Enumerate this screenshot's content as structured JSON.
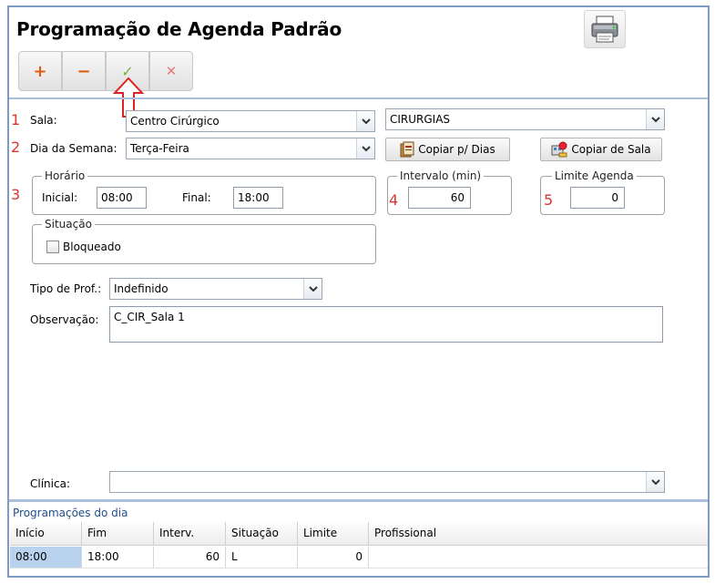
{
  "title": "Programação de Agenda Padrão",
  "toolbar": {
    "add": "+",
    "remove": "−",
    "confirm": "✓",
    "cancel": "✕"
  },
  "annotations": [
    "1",
    "2",
    "3",
    "4",
    "5"
  ],
  "form": {
    "sala_label": "Sala:",
    "sala_value": "Centro Cirúrgico",
    "sala_group_value": "CIRURGIAS",
    "dia_label": "Dia da Semana:",
    "dia_value": "Terça-Feira",
    "copiar_dias": "Copiar p/ Dias",
    "copiar_sala": "Copiar de Sala",
    "horario_legend": "Horário",
    "inicial_label": "Inicial:",
    "inicial_value": "08:00",
    "final_label": "Final:",
    "final_value": "18:00",
    "intervalo_legend": "Intervalo (min)",
    "intervalo_value": "60",
    "limite_legend": "Limite Agenda",
    "limite_value": "0",
    "situacao_legend": "Situação",
    "bloqueado_label": "Bloqueado",
    "tipo_prof_label": "Tipo de Prof.:",
    "tipo_prof_value": "Indefinido",
    "observacao_label": "Observação:",
    "observacao_value": "C_CIR_Sala 1",
    "clinica_label": "Clínica:",
    "clinica_value": ""
  },
  "grid": {
    "title": "Programações do dia",
    "columns": [
      "Início",
      "Fim",
      "Interv.",
      "Situação",
      "Limite",
      "Profissional"
    ],
    "rows": [
      {
        "inicio": "08:00",
        "fim": "18:00",
        "interv": "60",
        "situacao": "L",
        "limite": "0",
        "profissional": ""
      }
    ]
  },
  "colors": {
    "accent_border": "#7d9cc4",
    "annotation_red": "#dd3333",
    "selected_cell": "#b9d3ef"
  },
  "icons": [
    "printer-icon",
    "copy-days-icon",
    "copy-room-icon",
    "arrow-up-annotation-icon",
    "chevron-down-icon"
  ]
}
